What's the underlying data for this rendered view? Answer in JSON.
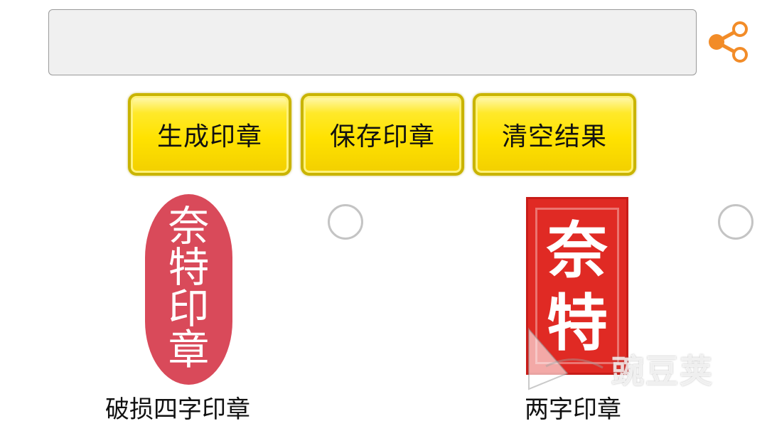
{
  "input": {
    "value": "",
    "placeholder": ""
  },
  "share": {
    "icon": "share-icon",
    "color": "#f28c28"
  },
  "buttons": {
    "generate_label": "生成印章",
    "save_label": "保存印章",
    "clear_label": "清空结果",
    "color": "#ffe200"
  },
  "results": [
    {
      "seal_chars": [
        "奈",
        "特",
        "印",
        "章"
      ],
      "caption": "破损四字印章",
      "seal_color": "#d94a5a",
      "selected": false
    },
    {
      "seal_chars": [
        "奈",
        "特"
      ],
      "caption": "两字印章",
      "seal_color": "#e02a24",
      "selected": false
    }
  ],
  "watermark": {
    "text": "豌豆荚"
  }
}
